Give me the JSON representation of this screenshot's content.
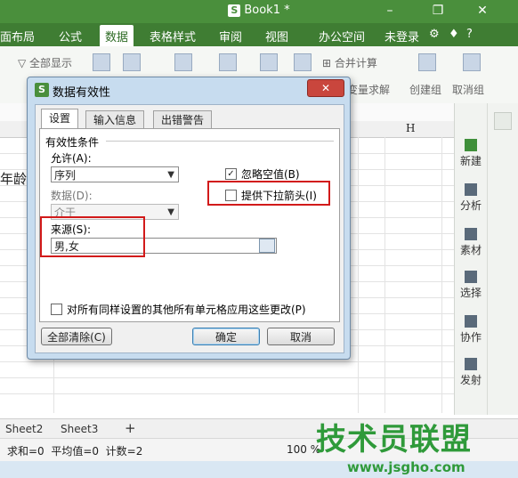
{
  "window": {
    "title": "Book1 *"
  },
  "menu": [
    "面布局",
    "公式",
    "数据",
    "表格样式",
    "审阅",
    "视图",
    "办公空间",
    "未登录"
  ],
  "ribbon": {
    "show_all": "全部显示",
    "merge_calc": "合并计算",
    "var_solve": "变量求解",
    "create_group": "创建组",
    "cancel_group": "取消组"
  },
  "sheet": {
    "cell_text": "年龄",
    "col_h": "H"
  },
  "right_panel": [
    "新建",
    "分析",
    "素材",
    "选择",
    "协作",
    "发射"
  ],
  "sheet_tabs": [
    "Sheet2",
    "Sheet3"
  ],
  "status": {
    "text": "求和=0  平均值=0  计数=2",
    "zoom": "100 %"
  },
  "dialog": {
    "title": "数据有效性",
    "tabs": [
      "设置",
      "输入信息",
      "出错警告"
    ],
    "section": "有效性条件",
    "allow_label": "允许(A):",
    "allow_value": "序列",
    "data_label": "数据(D):",
    "data_value": "介于",
    "ignore_blank": "忽略空值(B)",
    "ignore_blank_checked": true,
    "dropdown_arrow": "提供下拉箭头(I)",
    "dropdown_arrow_checked": false,
    "source_label": "来源(S):",
    "source_value": "男,女",
    "apply_all": "对所有同样设置的其他所有单元格应用这些更改(P)",
    "clear_all": "全部清除(C)",
    "ok": "确定",
    "cancel": "取消"
  },
  "watermark": {
    "name": "技术员联盟",
    "url": "www.jsgho.com"
  },
  "colors": {
    "title_bar": "#4a8f3c",
    "highlight": "#d21a1a",
    "watermark": "#2f9a3a"
  }
}
